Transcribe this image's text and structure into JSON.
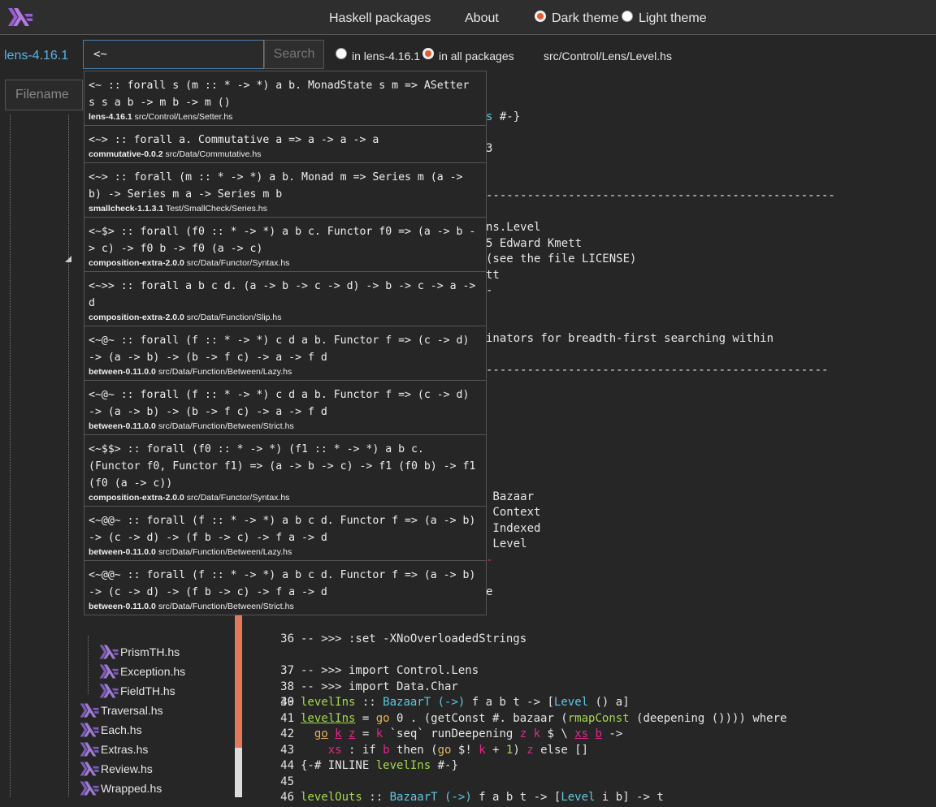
{
  "header": {
    "nav_packages": "Haskell packages",
    "nav_about": "About",
    "theme_dark": "Dark theme",
    "theme_light": "Light theme",
    "theme_selected": "dark"
  },
  "toolbar": {
    "package": "lens-4.16.1",
    "search_value": "<~",
    "search_button": "Search",
    "scope_package": "in lens-4.16.1",
    "scope_all": "in all packages",
    "scope_selected": "all",
    "file_path": "src/Control/Lens/Level.hs"
  },
  "sidebar": {
    "filename_placeholder": "Filename",
    "items": [
      {
        "label": "PrismTH.hs"
      },
      {
        "label": "Exception.hs"
      },
      {
        "label": "FieldTH.hs"
      },
      {
        "label": "Traversal.hs"
      },
      {
        "label": "Each.hs"
      },
      {
        "label": "Extras.hs"
      },
      {
        "label": "Review.hs"
      },
      {
        "label": "Wrapped.hs"
      }
    ]
  },
  "suggestions": [
    {
      "sig": "<~ :: forall s (m :: * -> *) a b. MonadState s m => ASetter s s a b -> m b -> m ()",
      "pkg": "lens-4.16.1",
      "path": "src/Control/Lens/Setter.hs"
    },
    {
      "sig": "<~> :: forall a. Commutative a => a -> a -> a",
      "pkg": "commutative-0.0.2",
      "path": "src/Data/Commutative.hs"
    },
    {
      "sig": "<~> :: forall (m :: * -> *) a b. Monad m => Series m (a -> b) -> Series m a -> Series m b",
      "pkg": "smallcheck-1.1.3.1",
      "path": "Test/SmallCheck/Series.hs"
    },
    {
      "sig": "<~$> :: forall (f0 :: * -> *) a b c. Functor f0 => (a -> b -> c) -> f0 b -> f0 (a -> c)",
      "pkg": "composition-extra-2.0.0",
      "path": "src/Data/Functor/Syntax.hs"
    },
    {
      "sig": "<~>> :: forall a b c d. (a -> b -> c -> d) -> b -> c -> a -> d",
      "pkg": "composition-extra-2.0.0",
      "path": "src/Data/Function/Slip.hs"
    },
    {
      "sig": "<~@~ :: forall (f :: * -> *) c d a b. Functor f => (c -> d) -> (a -> b) -> (b -> f c) -> a -> f d",
      "pkg": "between-0.11.0.0",
      "path": "src/Data/Function/Between/Lazy.hs"
    },
    {
      "sig": "<~@~ :: forall (f :: * -> *) c d a b. Functor f => (c -> d) -> (a -> b) -> (b -> f c) -> a -> f d",
      "pkg": "between-0.11.0.0",
      "path": "src/Data/Function/Between/Strict.hs"
    },
    {
      "sig": "<~$$> :: forall (f0 :: * -> *) (f1 :: * -> *) a b c. (Functor f0, Functor f1) => (a -> b -> c) -> f1 (f0 b) -> f1 (f0 (a -> c))",
      "pkg": "composition-extra-2.0.0",
      "path": "src/Data/Functor/Syntax.hs"
    },
    {
      "sig": "<~@@~ :: forall (f :: * -> *) a b c d. Functor f => (a -> b) -> (c -> d) -> (f b -> c) -> f a -> d",
      "pkg": "between-0.11.0.0",
      "path": "src/Data/Function/Between/Lazy.hs"
    },
    {
      "sig": "<~@@~ :: forall (f :: * -> *) a b c d. Functor f => (a -> b) -> (c -> d) -> (f b -> c) -> f a -> d",
      "pkg": "between-0.11.0.0",
      "path": "src/Data/Function/Between/Strict.hs"
    }
  ],
  "code_fragments": {
    "f1": "s #-}",
    "f2": "3",
    "f3": "---------------------------------------------------",
    "f4": "ns.Level",
    "f5": "5 Edward Kmett",
    "f6": "(see the file LICENSE)",
    "f7": "tt",
    "f8": "-",
    "f9": "inators for breadth-first searching within",
    "f10": "--------------------------------------------------",
    "f11": " Bazaar",
    "f12": " Context",
    "f13": " Indexed",
    "f14": " Level",
    "f15": "e"
  },
  "code": {
    "l36_num": "36",
    "l36": "-- >>> :set -XNoOverloadedStrings",
    "l37_num": "37",
    "l37": "-- >>> import Control.Lens",
    "l38_num": "38",
    "l38": "-- >>> import Data.Char",
    "l39_num": "39",
    "l40_num": "40",
    "l41_num": "41",
    "l42_num": "42",
    "l43_num": "43",
    "l44_num": "44",
    "l45_num": "45",
    "l46_num": "46",
    "levelIns": "levelIns",
    "l40_rest": " :: ",
    "bazaarT": "BazaarT",
    "arrow": "(->)",
    "fabt": " f a b t -> [",
    "level": "Level",
    "l40_tail": " () a]",
    "l41_eq": " = ",
    "go": "go",
    "l41_mid": " 0 . (getConst #. bazaar (",
    "rmapConst": "rmapConst",
    "l41_tail": " (deepening ()))) where",
    "k": "k",
    "z": "z",
    "l42_mid1": " `seq` runDeepening ",
    "l42_mid2": " $ \\ ",
    "xs": "xs",
    "b": "b",
    "l42_tail": " ->",
    "l43_colon": " : if ",
    "l43_then": " then (",
    "l43_bang": " $! ",
    "l43_plus": " + ",
    "one": "1",
    "l43_close": ") ",
    "l43_tail": " else []",
    "l44": "{-# INLINE ",
    "l44_tail": " #-}",
    "levelOuts": "levelOuts",
    "l46_rest": " :: ",
    "l46_tail": " f a b t -> [",
    "l46_level_tail": " i b] -> t"
  },
  "colors": {
    "accent": "#e35c2f",
    "keyword_cyan": "#5fc8e0",
    "function_green": "#a6d94a",
    "variable_magenta": "#e02a8a",
    "package_blue": "#5bb3e6"
  }
}
